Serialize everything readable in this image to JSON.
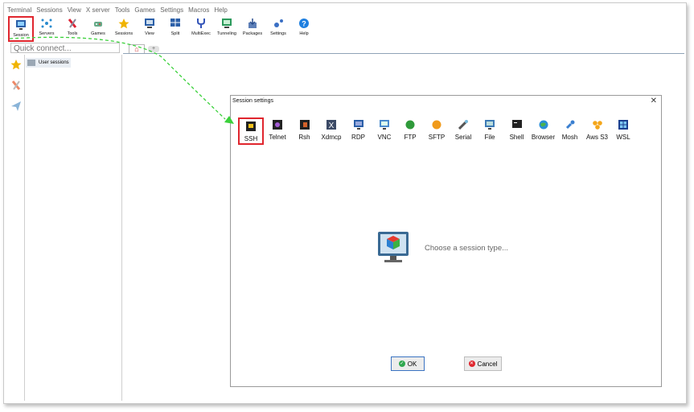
{
  "menu": [
    "Terminal",
    "Sessions",
    "View",
    "X server",
    "Tools",
    "Games",
    "Settings",
    "Macros",
    "Help"
  ],
  "toolbar": [
    {
      "label": "Session",
      "icon": "monitor-icon"
    },
    {
      "label": "Servers",
      "icon": "servers-icon"
    },
    {
      "label": "Tools",
      "icon": "tools-icon"
    },
    {
      "label": "Games",
      "icon": "games-icon"
    },
    {
      "label": "Sessions",
      "icon": "star-icon"
    },
    {
      "label": "View",
      "icon": "view-icon"
    },
    {
      "label": "Split",
      "icon": "split-icon"
    },
    {
      "label": "MultiExec",
      "icon": "fork-icon"
    },
    {
      "label": "Tunneling",
      "icon": "tunneling-icon"
    },
    {
      "label": "Packages",
      "icon": "packages-icon"
    },
    {
      "label": "Settings",
      "icon": "gear-icon"
    },
    {
      "label": "Help",
      "icon": "help-icon"
    }
  ],
  "quick_connect": {
    "placeholder": "Quick connect..."
  },
  "sidebar": {
    "user_sessions": "User sessions"
  },
  "dialog": {
    "title": "Session settings",
    "close": "✕",
    "session_types": [
      "SSH",
      "Telnet",
      "Rsh",
      "Xdmcp",
      "RDP",
      "VNC",
      "FTP",
      "SFTP",
      "Serial",
      "File",
      "Shell",
      "Browser",
      "Mosh",
      "Aws S3",
      "WSL"
    ],
    "prompt": "Choose a session type...",
    "ok": "OK",
    "cancel": "Cancel"
  },
  "colors": {
    "highlight": "#e0262e",
    "arrow": "#3bd13b"
  }
}
